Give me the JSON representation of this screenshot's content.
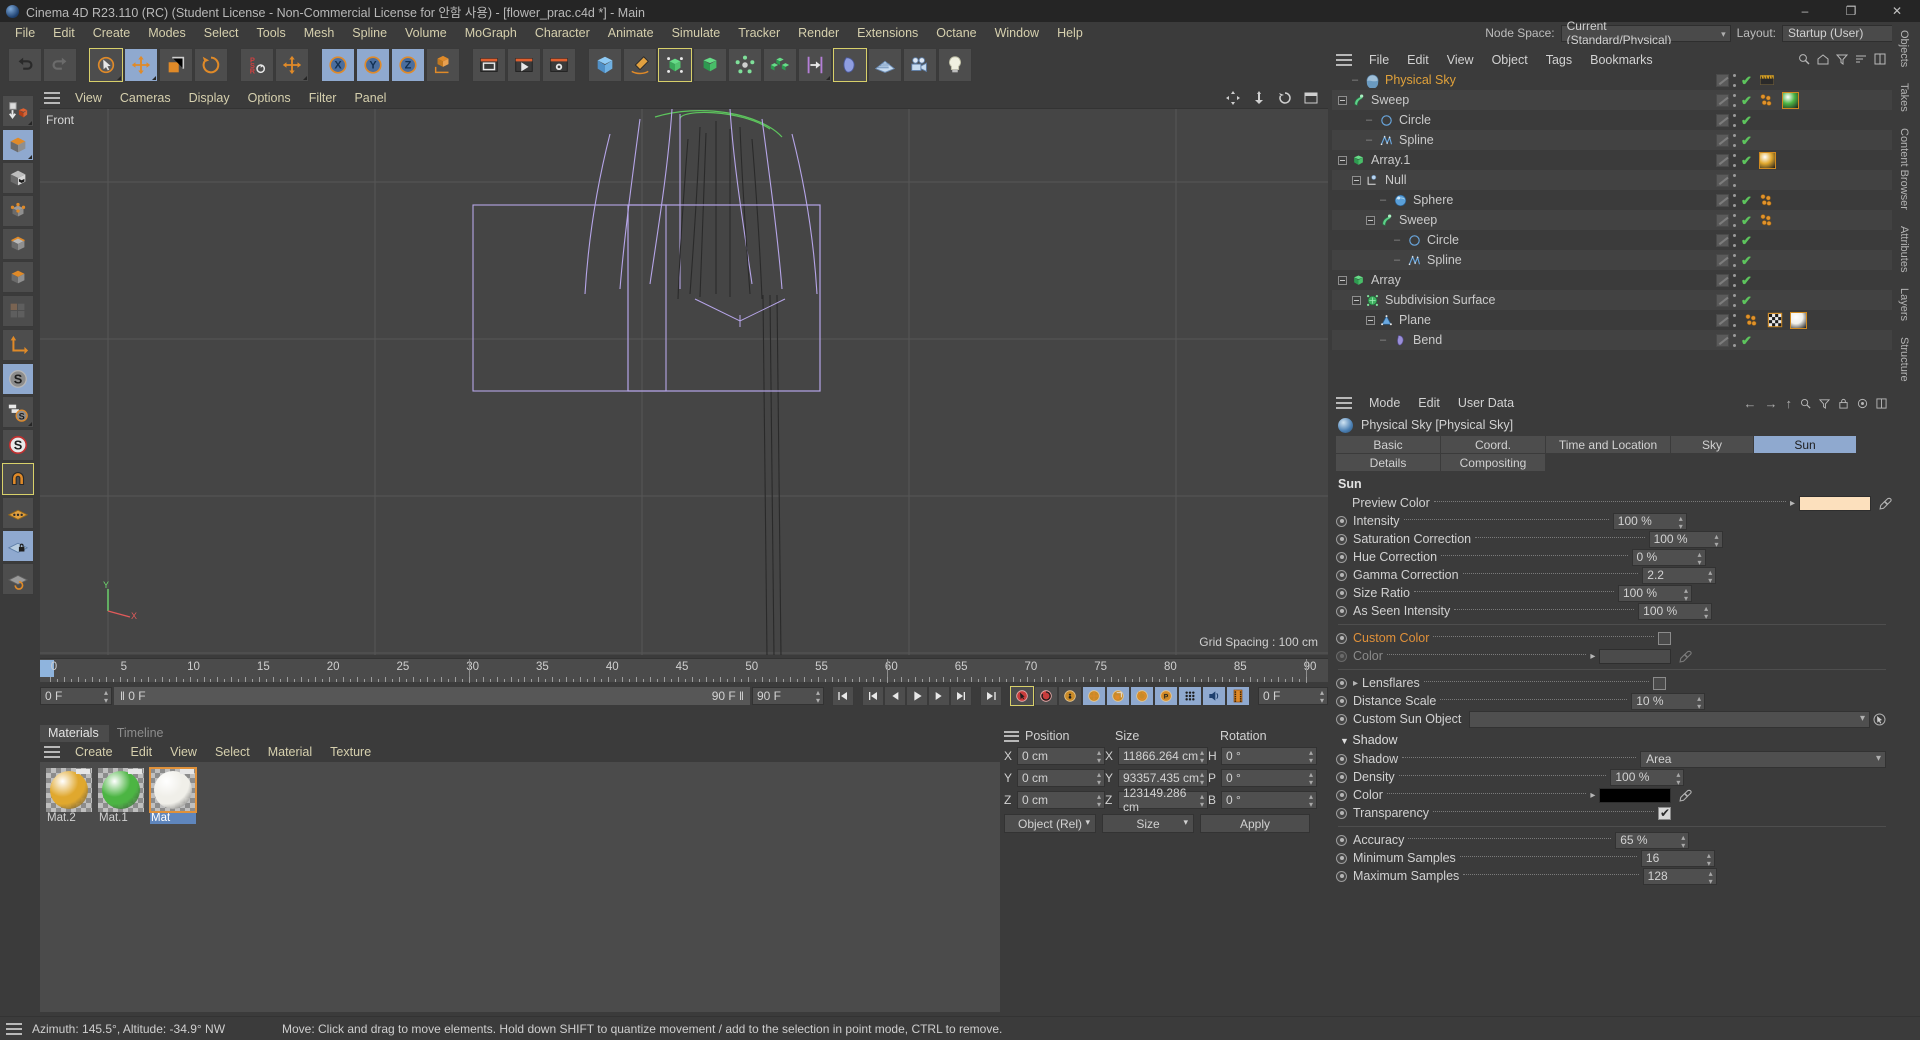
{
  "window": {
    "title": "Cinema 4D R23.110 (RC) (Student License - Non-Commercial License for 안함 사용) - [flower_prac.c4d *] - Main",
    "minimize": "–",
    "maximize": "❐",
    "close": "✕"
  },
  "menubar": {
    "items": [
      "File",
      "Edit",
      "Create",
      "Modes",
      "Select",
      "Tools",
      "Mesh",
      "Spline",
      "Volume",
      "MoGraph",
      "Character",
      "Animate",
      "Simulate",
      "Tracker",
      "Render",
      "Extensions",
      "Octane",
      "Window",
      "Help"
    ],
    "node_space_label": "Node Space:",
    "node_space_value": "Current (Standard/Physical)",
    "layout_label": "Layout:",
    "layout_value": "Startup (User)"
  },
  "toolbar": {
    "groups": [
      {
        "name": "history",
        "buttons": [
          {
            "name": "undo-button",
            "icon": "undo"
          },
          {
            "name": "redo-button",
            "icon": "redo"
          }
        ]
      },
      {
        "name": "transform",
        "buttons": [
          {
            "name": "live-selection-button",
            "icon": "cursor-circle",
            "state": "selected"
          },
          {
            "name": "move-tool-button",
            "icon": "move",
            "state": "on"
          },
          {
            "name": "scale-tool-button",
            "icon": "scale"
          },
          {
            "name": "rotate-tool-button",
            "icon": "rotate"
          }
        ]
      },
      {
        "name": "psr",
        "buttons": [
          {
            "name": "psr-button",
            "icon": "psr"
          },
          {
            "name": "world-object-button",
            "icon": "move-axis"
          }
        ]
      },
      {
        "name": "axis-lock",
        "buttons": [
          {
            "name": "lock-x-button",
            "icon": "x-axis",
            "state": "on"
          },
          {
            "name": "lock-y-button",
            "icon": "y-axis",
            "state": "on"
          },
          {
            "name": "lock-z-button",
            "icon": "z-axis",
            "state": "on"
          },
          {
            "name": "world-coordinate-button",
            "icon": "world-cube"
          }
        ]
      },
      {
        "name": "render",
        "buttons": [
          {
            "name": "render-view-button",
            "icon": "render-view"
          },
          {
            "name": "render-to-picture-viewer-button",
            "icon": "render-picture"
          },
          {
            "name": "render-settings-button",
            "icon": "render-settings"
          }
        ]
      },
      {
        "name": "create",
        "buttons": [
          {
            "name": "add-cube-button",
            "icon": "cube-blue"
          },
          {
            "name": "add-spline-button",
            "icon": "pen-spline"
          },
          {
            "name": "nurbs-button",
            "icon": "nurbs",
            "state": "selected"
          },
          {
            "name": "array-button",
            "icon": "array-green"
          },
          {
            "name": "scene-button",
            "icon": "scene-gray"
          },
          {
            "name": "modeling-object-button",
            "icon": "cubes-green"
          },
          {
            "name": "move-along-button",
            "icon": "align-bar"
          },
          {
            "name": "deformer-button",
            "icon": "bend-deformer",
            "state": "selected"
          },
          {
            "name": "environment-button",
            "icon": "floor-grid"
          },
          {
            "name": "camera-button",
            "icon": "camera"
          },
          {
            "name": "light-button",
            "icon": "bulb"
          }
        ]
      }
    ]
  },
  "left_toolbar": {
    "buttons": [
      {
        "name": "make-editable-button",
        "icon": "make-editable"
      },
      {
        "name": "model-mode-button",
        "icon": "model-cube",
        "state": "on"
      },
      {
        "name": "texture-mode-button",
        "icon": "texture-cube"
      },
      {
        "name": "point-mode-button",
        "icon": "points-cube"
      },
      {
        "name": "edge-mode-button",
        "icon": "edges-cube"
      },
      {
        "name": "polygon-mode-button",
        "icon": "polygon-cube"
      },
      {
        "name": "uv-mode-button",
        "icon": "uv-tiles"
      },
      {
        "name": "axis-modify-button",
        "icon": "axis-l"
      },
      {
        "name": "enable-snap-button",
        "icon": "s-gray",
        "state": "on"
      },
      {
        "name": "snap-settings-button",
        "icon": "s-tooltip"
      },
      {
        "name": "quantize-button",
        "icon": "s-red"
      },
      {
        "name": "workplane-magnet-button",
        "icon": "magnet",
        "state": "selected"
      },
      {
        "name": "workplane-button",
        "icon": "plane-orange"
      },
      {
        "name": "lock-workplane-button",
        "icon": "plane-lock",
        "state": "on"
      },
      {
        "name": "planar-workplane-button",
        "icon": "plane-rotate"
      }
    ]
  },
  "viewport": {
    "menus": [
      "View",
      "Cameras",
      "Display",
      "Options",
      "Filter",
      "Panel"
    ],
    "label": "Front",
    "grid_spacing": "Grid Spacing : 100 cm",
    "icons": [
      "pan-icon",
      "zoom-icon",
      "rotate-icon",
      "maximize-icon"
    ],
    "axis": {
      "y": "Y",
      "x": "X"
    }
  },
  "timeline": {
    "ticks": [
      0,
      5,
      10,
      15,
      20,
      25,
      30,
      35,
      40,
      45,
      50,
      55,
      60,
      65,
      70,
      75,
      80,
      85,
      90
    ],
    "current_frame": "0 F",
    "start_field": "0 F",
    "preview_start": "0 F",
    "end_field": "90 F",
    "preview_end": "90 F",
    "right_frame": "0 F"
  },
  "transport": {
    "buttons": [
      {
        "name": "go-to-start-button",
        "icon": "skip-start"
      },
      {
        "name": "previous-keyframe-button",
        "icon": "prev-key"
      },
      {
        "name": "previous-frame-button",
        "icon": "prev-frame"
      },
      {
        "name": "play-button",
        "icon": "play"
      },
      {
        "name": "next-frame-button",
        "icon": "next-frame"
      },
      {
        "name": "next-keyframe-button",
        "icon": "next-key"
      },
      {
        "name": "go-to-end-button",
        "icon": "skip-end"
      },
      {
        "name": "record-active-objects-button",
        "icon": "record-key",
        "state": "selected"
      },
      {
        "name": "autokeying-button",
        "icon": "autokey"
      },
      {
        "name": "keyframe-selection-button",
        "icon": "key-selection"
      },
      {
        "name": "position-key-button",
        "icon": "position-key",
        "state": "on"
      },
      {
        "name": "scale-key-button",
        "icon": "scale-key",
        "state": "on"
      },
      {
        "name": "rotation-key-button",
        "icon": "rotation-key",
        "state": "on"
      },
      {
        "name": "param-key-button",
        "icon": "param-key",
        "state": "on"
      },
      {
        "name": "point-level-animation-button",
        "icon": "pla-dots",
        "state": "on"
      },
      {
        "name": "sound-button",
        "icon": "sound",
        "state": "on"
      },
      {
        "name": "timeline-filter-button",
        "icon": "film-strip",
        "state": "on"
      }
    ]
  },
  "materials": {
    "tabs": [
      {
        "label": "Materials",
        "active": true
      },
      {
        "label": "Timeline",
        "active": false
      }
    ],
    "menus": [
      "Create",
      "Edit",
      "View",
      "Select",
      "Material",
      "Texture"
    ],
    "items": [
      {
        "name": "Mat.2",
        "color": "#e0a82e",
        "selected": false
      },
      {
        "name": "Mat.1",
        "color": "#4cb543",
        "selected": false
      },
      {
        "name": "Mat",
        "color": "#f0efe9",
        "selected": true
      }
    ]
  },
  "coordinates": {
    "headers": [
      "Position",
      "Size",
      "Rotation"
    ],
    "rows": [
      {
        "pos_label": "X",
        "pos_value": "0 cm",
        "size_label": "X",
        "size_value": "11866.264 cm",
        "rot_label": "H",
        "rot_value": "0 °"
      },
      {
        "pos_label": "Y",
        "pos_value": "0 cm",
        "size_label": "Y",
        "size_value": "93357.435 cm",
        "rot_label": "P",
        "rot_value": "0 °"
      },
      {
        "pos_label": "Z",
        "pos_value": "0 cm",
        "size_label": "Z",
        "size_value": "123149.286 cm",
        "rot_label": "B",
        "rot_value": "0 °"
      }
    ],
    "mode_select": "Object (Rel)",
    "size_select": "Size",
    "apply_button": "Apply"
  },
  "object_manager": {
    "menus": [
      "File",
      "Edit",
      "View",
      "Object",
      "Tags",
      "Bookmarks"
    ],
    "icons": [
      "search-icon",
      "home-icon",
      "filter-icon",
      "sort-icon",
      "expand-icon"
    ],
    "rows": [
      {
        "name": "Physical Sky",
        "indent": 1,
        "icon": "sky-sphere",
        "highlight": true,
        "expander": false,
        "tags": [
          "box",
          "dots",
          "check"
        ],
        "extra": [
          "film-tag"
        ],
        "alt": false
      },
      {
        "name": "Sweep",
        "indent": 0,
        "icon": "sweep-green",
        "highlight": false,
        "expander": true,
        "tags": [
          "box",
          "dots",
          "check"
        ],
        "extra": [
          "mograph-tag",
          "material-green"
        ],
        "alt": true
      },
      {
        "name": "Circle",
        "indent": 2,
        "icon": "circle-blue",
        "highlight": false,
        "expander": false,
        "tags": [
          "box",
          "dots",
          "check"
        ],
        "extra": [],
        "alt": false
      },
      {
        "name": "Spline",
        "indent": 2,
        "icon": "spline-blue",
        "highlight": false,
        "expander": false,
        "tags": [
          "box",
          "dots",
          "check"
        ],
        "extra": [],
        "alt": true
      },
      {
        "name": "Array.1",
        "indent": 0,
        "icon": "array-green",
        "highlight": false,
        "expander": true,
        "tags": [
          "box",
          "dots",
          "check"
        ],
        "extra": [
          "material-gold"
        ],
        "alt": false
      },
      {
        "name": "Null",
        "indent": 1,
        "icon": "null-blue",
        "highlight": false,
        "expander": true,
        "tags": [
          "box",
          "dots"
        ],
        "extra": [],
        "alt": true
      },
      {
        "name": "Sphere",
        "indent": 3,
        "icon": "sphere-blue",
        "highlight": false,
        "expander": false,
        "tags": [
          "box",
          "dots",
          "check"
        ],
        "extra": [
          "mograph-tag"
        ],
        "alt": false
      },
      {
        "name": "Sweep",
        "indent": 2,
        "icon": "sweep-green",
        "highlight": false,
        "expander": true,
        "tags": [
          "box",
          "dots",
          "check"
        ],
        "extra": [
          "mograph-tag"
        ],
        "alt": true
      },
      {
        "name": "Circle",
        "indent": 4,
        "icon": "circle-blue",
        "highlight": false,
        "expander": false,
        "tags": [
          "box",
          "dots",
          "check"
        ],
        "extra": [],
        "alt": false
      },
      {
        "name": "Spline",
        "indent": 4,
        "icon": "spline-blue",
        "highlight": false,
        "expander": false,
        "tags": [
          "box",
          "dots",
          "check"
        ],
        "extra": [],
        "alt": true
      },
      {
        "name": "Array",
        "indent": 0,
        "icon": "array-green",
        "highlight": false,
        "expander": true,
        "tags": [
          "box",
          "dots",
          "check"
        ],
        "extra": [],
        "alt": false
      },
      {
        "name": "Subdivision Surface",
        "indent": 1,
        "icon": "subdiv-green",
        "highlight": false,
        "expander": true,
        "tags": [
          "box",
          "dots",
          "check"
        ],
        "extra": [],
        "alt": true
      },
      {
        "name": "Plane",
        "indent": 2,
        "icon": "plane-tri",
        "highlight": false,
        "expander": true,
        "tags": [
          "box",
          "dots"
        ],
        "extra": [
          "mograph-tag",
          "checker-tag",
          "material-white"
        ],
        "alt": false
      },
      {
        "name": "Bend",
        "indent": 3,
        "icon": "bend-purple",
        "highlight": false,
        "expander": false,
        "tags": [
          "box",
          "dots",
          "check"
        ],
        "extra": [],
        "alt": true
      }
    ]
  },
  "attributes": {
    "menus": [
      "Mode",
      "Edit",
      "User Data"
    ],
    "object_title": "Physical Sky [Physical Sky]",
    "tabs_row1": [
      {
        "label": "Basic",
        "active": false
      },
      {
        "label": "Coord.",
        "active": false
      },
      {
        "label": "Time and Location",
        "active": false
      },
      {
        "label": "Sky",
        "active": false
      },
      {
        "label": "Sun",
        "active": true
      }
    ],
    "tabs_row2": [
      {
        "label": "Details",
        "active": false
      },
      {
        "label": "Compositing",
        "active": false
      }
    ],
    "sun_group": "Sun",
    "preview_color_label": "Preview Color",
    "preview_color_value": "#fce0bd",
    "fields": [
      {
        "label": "Intensity",
        "value": "100 %"
      },
      {
        "label": "Saturation Correction",
        "value": "100 %"
      },
      {
        "label": "Hue Correction",
        "value": "0 %"
      },
      {
        "label": "Gamma Correction",
        "value": "2.2"
      },
      {
        "label": "Size Ratio",
        "value": "100 %"
      },
      {
        "label": "As Seen Intensity",
        "value": "100 %"
      }
    ],
    "custom_color_label": "Custom Color",
    "custom_color_checked": false,
    "color_label": "Color",
    "lensflares_label": "Lensflares",
    "lensflares_checked": false,
    "distance_scale_label": "Distance Scale",
    "distance_scale_value": "10 %",
    "custom_sun_object_label": "Custom Sun Object",
    "custom_sun_object_value": "",
    "shadow_group": "Shadow",
    "shadow_label": "Shadow",
    "shadow_value": "Area",
    "shadow_fields": [
      {
        "label": "Density",
        "value": "100 %"
      }
    ],
    "shadow_color_label": "Color",
    "shadow_color_value": "#000000",
    "transparency_label": "Transparency",
    "transparency_checked": true,
    "shadow_fields2": [
      {
        "label": "Accuracy",
        "value": "65 %"
      },
      {
        "label": "Minimum Samples",
        "value": "16"
      },
      {
        "label": "Maximum Samples",
        "value": "128"
      }
    ]
  },
  "right_tabs": [
    "Objects",
    "Takes",
    "Content Browser",
    "Attributes",
    "Layers",
    "Structure"
  ],
  "statusbar": {
    "left": "Azimuth: 145.5°, Altitude: -34.9°  NW",
    "message": "Move: Click and drag to move elements. Hold down SHIFT to quantize movement / add to the selection in point mode, CTRL to remove."
  }
}
